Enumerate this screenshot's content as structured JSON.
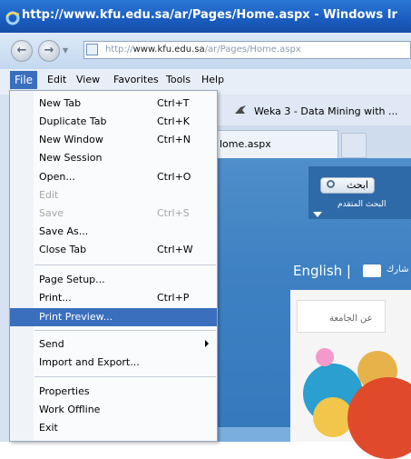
{
  "window": {
    "title": "http://www.kfu.edu.sa/ar/Pages/Home.aspx - Windows Ir"
  },
  "address_bar": {
    "url_prefix": "http://",
    "url_host": "www.kfu.edu.sa",
    "url_path": "/ar/Pages/Home.aspx"
  },
  "menubar": {
    "items": [
      "File",
      "Edit",
      "View",
      "Favorites",
      "Tools",
      "Help"
    ]
  },
  "favorites": {
    "link": "Weka 3 - Data Mining with ..."
  },
  "tab": {
    "label": "lome.aspx"
  },
  "file_menu": {
    "items": [
      {
        "label": "New Tab",
        "shortcut": "Ctrl+T"
      },
      {
        "label": "Duplicate Tab",
        "shortcut": "Ctrl+K"
      },
      {
        "label": "New Window",
        "shortcut": "Ctrl+N"
      },
      {
        "label": "New Session",
        "shortcut": ""
      },
      {
        "label": "Open...",
        "shortcut": "Ctrl+O"
      },
      {
        "label": "Edit",
        "shortcut": ""
      },
      {
        "label": "Save",
        "shortcut": "Ctrl+S"
      },
      {
        "label": "Save As...",
        "shortcut": ""
      },
      {
        "label": "Close Tab",
        "shortcut": "Ctrl+W"
      },
      {
        "label": "Page Setup...",
        "shortcut": ""
      },
      {
        "label": "Print...",
        "shortcut": "Ctrl+P"
      },
      {
        "label": "Print Preview...",
        "shortcut": ""
      },
      {
        "label": "Send",
        "shortcut": ""
      },
      {
        "label": "Import and Export...",
        "shortcut": ""
      },
      {
        "label": "Properties",
        "shortcut": ""
      },
      {
        "label": "Work Offline",
        "shortcut": ""
      },
      {
        "label": "Exit",
        "shortcut": ""
      }
    ]
  },
  "page": {
    "search_button": "ابحث",
    "advanced_search": "البحث المتقدم",
    "english_link": "English |",
    "share_text": "شارك",
    "about_tab": "عن الجامعة"
  },
  "colors": {
    "titlebar": "#1a5cbf",
    "menu_highlight": "#3a6fbe",
    "page_blue": "#3e81c3"
  }
}
